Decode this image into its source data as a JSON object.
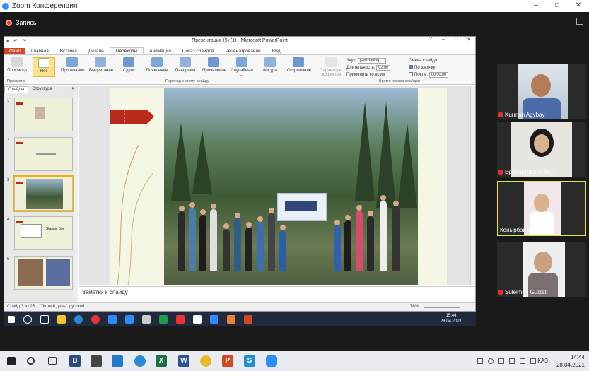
{
  "zoom": {
    "title": "Zoom Конференция",
    "recording_label": "Запись",
    "window_controls": [
      "–",
      "□",
      "✕"
    ]
  },
  "ppt": {
    "title": "Презентация (5) (1) - Microsoft PowerPoint",
    "tabs": [
      "Файл",
      "Главная",
      "Вставка",
      "Дизайн",
      "Переходы",
      "Анимация",
      "Показ слайдов",
      "Рецензирование",
      "Вид"
    ],
    "active_tab": "Переходы",
    "ribbon": {
      "preview": "Просмотр",
      "transitions": [
        "Нет",
        "Прорезание",
        "Выцветание",
        "Сдвиг",
        "Появление",
        "Панорама",
        "Проявление",
        "Случайные ...",
        "Фигура",
        "Открывание"
      ],
      "effect_params": "Параметры эффектов",
      "group_preview": "Просмотр",
      "group_transition": "Переход к этому слайду",
      "group_timing": "Время показа слайдов",
      "sound_label": "Звук:",
      "sound_value": "[Нет звука]",
      "duration_label": "Длительность:",
      "duration_value": "02,00",
      "apply_all": "Применить ко всем",
      "change_slide": "Смена слайда",
      "on_click": "По щелчку",
      "after": "После:",
      "after_value": "00:00,00"
    },
    "sidebar_tabs": [
      "Слайды",
      "Структура"
    ],
    "slide_numbers": [
      "1",
      "2",
      "3",
      "4",
      "5"
    ],
    "thumb4_text": "Жарыс Бот",
    "banner_text": "",
    "notes_placeholder": "Заметки к слайду",
    "status": {
      "slide_info": "Слайд 3 из 25",
      "theme": "\"Летний день\"",
      "language": "русский",
      "zoom": "76%"
    }
  },
  "inner_clock": {
    "time": "15:44",
    "date": "28.04.2021"
  },
  "participants": [
    {
      "name": "Kurman Agybay"
    },
    {
      "name": "Ерболатова З. №..."
    },
    {
      "name": "Конырбай Фариза"
    },
    {
      "name": "Suleimen Gulzat"
    }
  ],
  "taskbar": {
    "lang": "КАЗ",
    "time": "14:44",
    "date": "28.04.2021"
  }
}
